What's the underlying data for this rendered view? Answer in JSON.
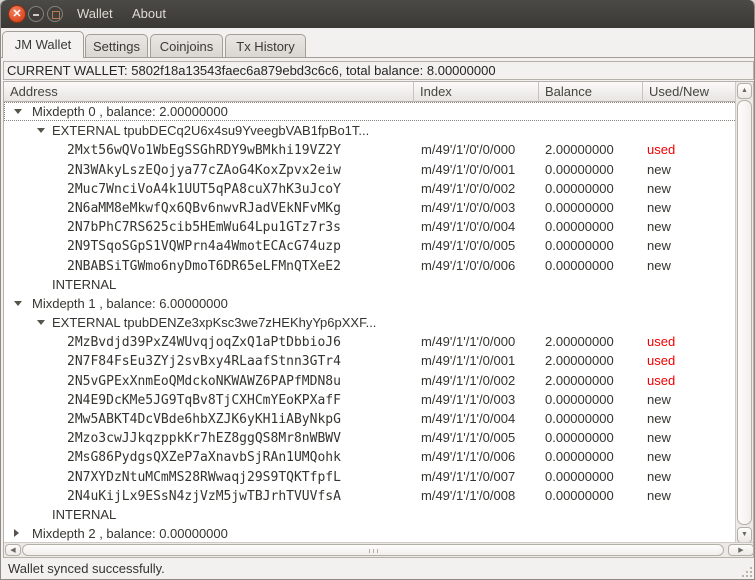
{
  "window": {
    "titlebar": {
      "menus": [
        "Wallet",
        "About"
      ]
    }
  },
  "tabs": [
    {
      "label": "JM Wallet",
      "active": true
    },
    {
      "label": "Settings",
      "active": false
    },
    {
      "label": "Coinjoins",
      "active": false
    },
    {
      "label": "Tx History",
      "active": false
    }
  ],
  "current_wallet_line": "CURRENT WALLET: 5802f18a13543faec6a879ebd3c6c6, total balance: 8.00000000",
  "table": {
    "columns": [
      "Address",
      "Index",
      "Balance",
      "Used/New"
    ],
    "rows": [
      {
        "type": "mixdepth",
        "level": 0,
        "expander": "open",
        "focused": true,
        "label": "Mixdepth 0 , balance: 2.00000000"
      },
      {
        "type": "branch",
        "level": 1,
        "expander": "open",
        "label": "EXTERNAL tpubDECq2U6x4su9YveegbVAB1fpBo1T..."
      },
      {
        "type": "address",
        "level": 2,
        "address": "2Mxt56wQVo1WbEgSSGhRDY9wBMkhi19VZ2Y",
        "index": "m/49'/1'/0'/0/000",
        "balance": "2.00000000",
        "status": "used"
      },
      {
        "type": "address",
        "level": 2,
        "address": "2N3WAkyLszEQojya77cZAoG4KoxZpvx2eiw",
        "index": "m/49'/1'/0'/0/001",
        "balance": "0.00000000",
        "status": "new"
      },
      {
        "type": "address",
        "level": 2,
        "address": "2Muc7WnciVoA4k1UUT5qPA8cuX7hK3uJcoY",
        "index": "m/49'/1'/0'/0/002",
        "balance": "0.00000000",
        "status": "new"
      },
      {
        "type": "address",
        "level": 2,
        "address": "2N6aMM8eMkwfQx6QBv6nwvRJadVEkNFvMKg",
        "index": "m/49'/1'/0'/0/003",
        "balance": "0.00000000",
        "status": "new"
      },
      {
        "type": "address",
        "level": 2,
        "address": "2N7bPhC7RS625cib5HEmWu64Lpu1GTz7r3s",
        "index": "m/49'/1'/0'/0/004",
        "balance": "0.00000000",
        "status": "new"
      },
      {
        "type": "address",
        "level": 2,
        "address": "2N9TSqoSGpS1VQWPrn4a4WmotECAcG74uzp",
        "index": "m/49'/1'/0'/0/005",
        "balance": "0.00000000",
        "status": "new"
      },
      {
        "type": "address",
        "level": 2,
        "address": "2NBABSiTGWmo6nyDmoT6DR65eLFMnQTXeE2",
        "index": "m/49'/1'/0'/0/006",
        "balance": "0.00000000",
        "status": "new"
      },
      {
        "type": "branch",
        "level": 1,
        "expander": "none",
        "label": "INTERNAL"
      },
      {
        "type": "mixdepth",
        "level": 0,
        "expander": "open",
        "label": "Mixdepth 1 , balance: 6.00000000"
      },
      {
        "type": "branch",
        "level": 1,
        "expander": "open",
        "label": "EXTERNAL tpubDENZe3xpKsc3we7zHEKhyYp6pXXF..."
      },
      {
        "type": "address",
        "level": 2,
        "address": "2MzBvdjd39PxZ4WUvqjoqZxQ1aPtDbbioJ6",
        "index": "m/49'/1'/1'/0/000",
        "balance": "2.00000000",
        "status": "used"
      },
      {
        "type": "address",
        "level": 2,
        "address": "2N7F84FsEu3ZYj2svBxy4RLaafStnn3GTr4",
        "index": "m/49'/1'/1'/0/001",
        "balance": "2.00000000",
        "status": "used"
      },
      {
        "type": "address",
        "level": 2,
        "address": "2N5vGPExXnmEoQMdckoNKWAWZ6PAPfMDN8u",
        "index": "m/49'/1'/1'/0/002",
        "balance": "2.00000000",
        "status": "used"
      },
      {
        "type": "address",
        "level": 2,
        "address": "2N4E9DcKMe5JG9TqBv8TjCXHCmYEoKPXafF",
        "index": "m/49'/1'/1'/0/003",
        "balance": "0.00000000",
        "status": "new"
      },
      {
        "type": "address",
        "level": 2,
        "address": "2Mw5ABKT4DcVBde6hbXZJK6yKH1iAByNkpG",
        "index": "m/49'/1'/1'/0/004",
        "balance": "0.00000000",
        "status": "new"
      },
      {
        "type": "address",
        "level": 2,
        "address": "2Mzo3cwJJkqzppkKr7hEZ8ggQS8Mr8nWBWV",
        "index": "m/49'/1'/1'/0/005",
        "balance": "0.00000000",
        "status": "new"
      },
      {
        "type": "address",
        "level": 2,
        "address": "2MsG86PydgsQXZeP7aXnavbSjRAn1UMQohk",
        "index": "m/49'/1'/1'/0/006",
        "balance": "0.00000000",
        "status": "new"
      },
      {
        "type": "address",
        "level": 2,
        "address": "2N7XYDzNtuMCmMS28RWwaqj29S9TQKTfpfL",
        "index": "m/49'/1'/1'/0/007",
        "balance": "0.00000000",
        "status": "new"
      },
      {
        "type": "address",
        "level": 2,
        "address": "2N4uKijLx9ESsN4zjVzM5jwTBJrhTVUVfsA",
        "index": "m/49'/1'/1'/0/008",
        "balance": "0.00000000",
        "status": "new"
      },
      {
        "type": "branch",
        "level": 1,
        "expander": "none",
        "label": "INTERNAL"
      },
      {
        "type": "mixdepth",
        "level": 0,
        "expander": "closed",
        "label": "Mixdepth 2 , balance: 0.00000000"
      }
    ]
  },
  "status_bar": {
    "message": "Wallet synced successfully."
  },
  "colors": {
    "used_text": "#ee0000",
    "titlebar_bg": "#3c3b37",
    "close_button": "#de4b24",
    "window_bg": "#f2f1f0"
  }
}
